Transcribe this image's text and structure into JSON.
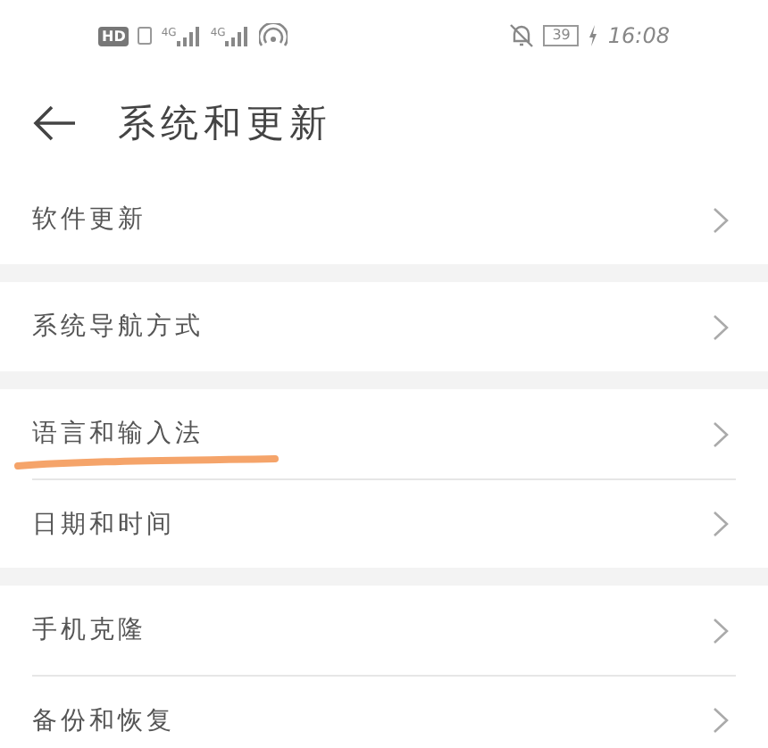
{
  "status_bar": {
    "hd_label": "HD",
    "signal_labels": [
      "4G",
      "4G"
    ],
    "battery": "39",
    "time": "16:08"
  },
  "header": {
    "title": "系统和更新"
  },
  "groups": [
    {
      "items": [
        {
          "label": "软件更新",
          "underlined": false
        }
      ]
    },
    {
      "items": [
        {
          "label": "系统导航方式",
          "underlined": false
        }
      ]
    },
    {
      "items": [
        {
          "label": "语言和输入法",
          "underlined": true
        },
        {
          "label": "日期和时间",
          "underlined": false
        }
      ]
    },
    {
      "items": [
        {
          "label": "手机克隆",
          "underlined": false
        },
        {
          "label": "备份和恢复",
          "underlined": false
        }
      ]
    }
  ]
}
